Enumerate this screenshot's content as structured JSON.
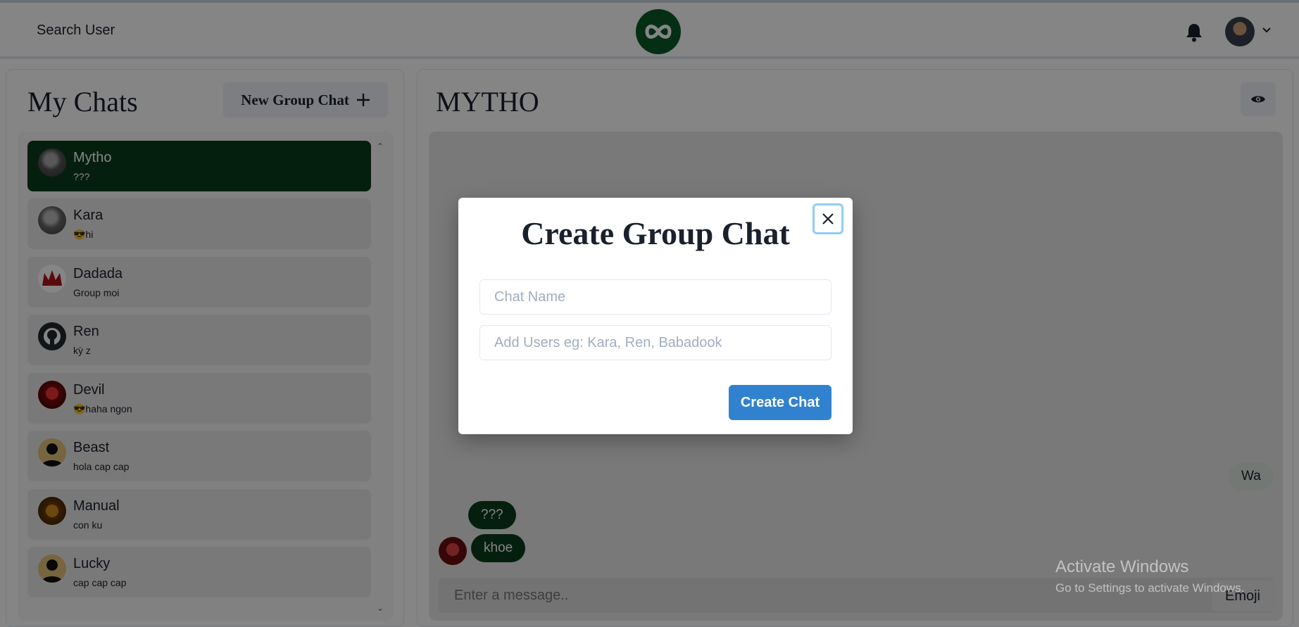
{
  "header": {
    "search_label": "Search User",
    "logo_icon": "infinity-logo-icon",
    "bell_icon": "bell-icon",
    "profile_dropdown_icon": "chevron-down-icon"
  },
  "left_panel": {
    "title": "My Chats",
    "new_group_button": "New Group Chat",
    "new_group_icon": "plus-icon",
    "chats": [
      {
        "name": "Mytho",
        "latest": "???",
        "selected": true
      },
      {
        "name": "Kara",
        "latest": "😎hi",
        "selected": false
      },
      {
        "name": "Dadada",
        "latest": "Group moi",
        "selected": false
      },
      {
        "name": "Ren",
        "latest": "kỳ z",
        "selected": false
      },
      {
        "name": "Devil",
        "latest": "😎haha ngon",
        "selected": false
      },
      {
        "name": "Beast",
        "latest": "hola cap cap",
        "selected": false
      },
      {
        "name": "Manual",
        "latest": "con ku",
        "selected": false
      },
      {
        "name": "Lucky",
        "latest": "cap cap cap",
        "selected": false
      }
    ]
  },
  "conversation": {
    "title": "MYTHO",
    "view_icon": "eye-icon",
    "messages": [
      {
        "text": "Wa",
        "from": "me"
      },
      {
        "text": "???",
        "from": "other"
      },
      {
        "text": "khoe",
        "from": "other"
      }
    ],
    "input_placeholder": "Enter a message..",
    "emoji_button": "Emoji"
  },
  "modal": {
    "title": "Create Group Chat",
    "close_icon": "close-icon",
    "chat_name_placeholder": "Chat Name",
    "users_placeholder": "Add Users eg: Kara, Ren, Babadook",
    "create_button": "Create Chat"
  },
  "watermark": {
    "line1": "Activate Windows",
    "line2": "Go to Settings to activate Windows."
  },
  "colors": {
    "selected_chat": "#0a3d1d",
    "primary_button": "#3182ce",
    "focus_ring": "#90cdf4"
  }
}
